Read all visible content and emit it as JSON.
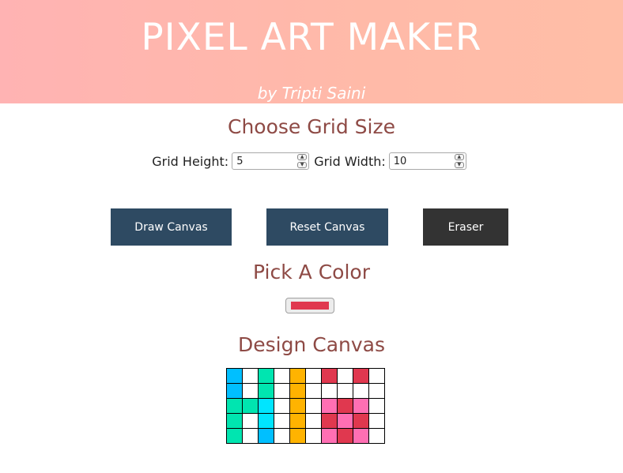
{
  "header": {
    "title": "PIXEL ART MAKER",
    "byline": "by Tripti Saini"
  },
  "grid_size": {
    "title": "Choose Grid Size",
    "height_label": "Grid Height:",
    "height_value": "5",
    "width_label": "Grid Width:",
    "width_value": "10"
  },
  "buttons": {
    "draw": "Draw Canvas",
    "reset": "Reset Canvas",
    "eraser": "Eraser"
  },
  "color": {
    "title": "Pick A Color",
    "selected": "#e0384f"
  },
  "canvas": {
    "title": "Design Canvas",
    "rows": 5,
    "cols": 10,
    "cells": [
      [
        "#00bfff",
        "#ffffff",
        "#00e5b0",
        "#ffffff",
        "#ffb300",
        "#ffffff",
        "#e0384f",
        "#ffffff",
        "#e0384f",
        "#ffffff"
      ],
      [
        "#00bfff",
        "#ffffff",
        "#00e5b0",
        "#ffffff",
        "#ffb300",
        "#ffffff",
        "#ffffff",
        "#ffffff",
        "#ffffff",
        "#ffffff"
      ],
      [
        "#00e5b0",
        "#00e5b0",
        "#00e5ff",
        "#ffffff",
        "#ffb300",
        "#ffffff",
        "#ff6fb3",
        "#e0384f",
        "#ff6fb3",
        "#ffffff"
      ],
      [
        "#00e5b0",
        "#ffffff",
        "#00e5ff",
        "#ffffff",
        "#ffb300",
        "#ffffff",
        "#e0384f",
        "#ff6fb3",
        "#e0384f",
        "#ffffff"
      ],
      [
        "#00e5b0",
        "#ffffff",
        "#00bfff",
        "#ffffff",
        "#ffb300",
        "#ffffff",
        "#ff6fb3",
        "#e0384f",
        "#ff6fb3",
        "#ffffff"
      ]
    ]
  }
}
